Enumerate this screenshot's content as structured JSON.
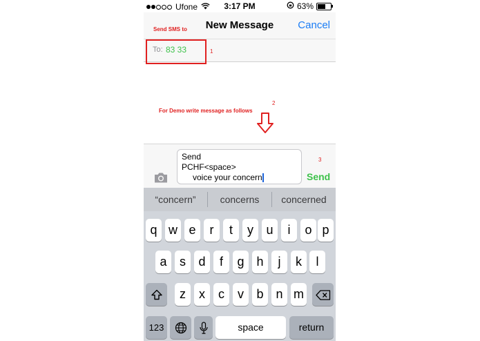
{
  "status_bar": {
    "carrier": "Ufone",
    "time": "3:17 PM",
    "battery": "63%",
    "battery_level": 0.63,
    "signal_bars_filled": 2,
    "signal_bars_total": 5
  },
  "nav": {
    "title": "New Message",
    "cancel_label": "Cancel"
  },
  "recipient": {
    "label": "To:",
    "value": "83 33"
  },
  "annotations": {
    "send_sms_to": "Send SMS to",
    "marker_1": "1",
    "demo_text": "For Demo write message as follows",
    "marker_2": "2",
    "marker_3": "3",
    "color": "#e02020"
  },
  "compose": {
    "line1": "Send",
    "line2": "PCHF<space>",
    "line3": "voice your concern",
    "send_label": "Send",
    "camera_icon": "camera-icon"
  },
  "keyboard": {
    "suggestions": [
      "“concern”",
      "concerns",
      "concerned"
    ],
    "row1": [
      "q",
      "w",
      "e",
      "r",
      "t",
      "y",
      "u",
      "i",
      "o",
      "p"
    ],
    "row2": [
      "a",
      "s",
      "d",
      "f",
      "g",
      "h",
      "j",
      "k",
      "l"
    ],
    "row3": [
      "z",
      "x",
      "c",
      "v",
      "b",
      "n",
      "m"
    ],
    "numbers_label": "123",
    "space_label": "space",
    "return_label": "return",
    "icons": [
      "shift-icon",
      "delete-icon",
      "globe-icon",
      "microphone-icon"
    ]
  },
  "colors": {
    "accent_blue": "#1a7cf5",
    "sms_green": "#3ec24b",
    "annotation_red": "#e02020"
  }
}
